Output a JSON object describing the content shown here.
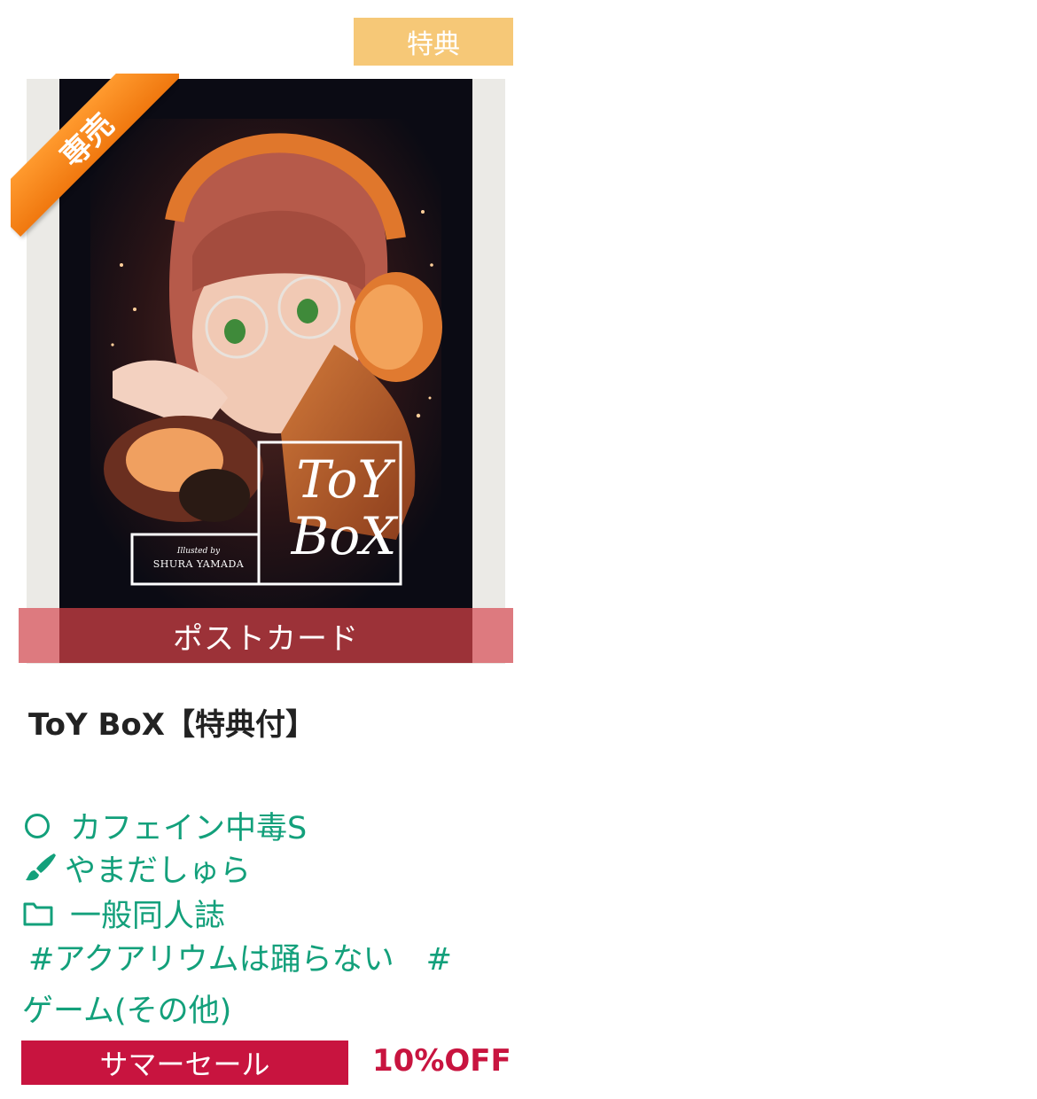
{
  "badge": {
    "label": "特典"
  },
  "cover": {
    "title_line1": "ToY",
    "title_line2": "BoX",
    "credit_small": "Illusted by",
    "credit_name": "SHURA YAMADA"
  },
  "ribbon": {
    "label": "専売"
  },
  "format_bar": {
    "label": "ポストカード"
  },
  "product": {
    "title": "ToY BoX【特典付】"
  },
  "meta": {
    "circle": "カフェイン中毒S",
    "artist": "やまだしゅら",
    "category": "一般同人誌",
    "tag1": "#アクアリウムは踊らない",
    "tag2_hash": "#",
    "tag2_text": "ゲーム(その他)"
  },
  "sale": {
    "label": "サマーセール",
    "discount": "10%OFF"
  },
  "colors": {
    "accent_green": "#13a07b",
    "sale_red": "#c8143f",
    "badge_yellow": "#f6c877",
    "ribbon_orange": "#f0780f"
  },
  "icons": {
    "circle": "circle-icon",
    "artist": "paintbrush-icon",
    "category": "folder-icon"
  }
}
